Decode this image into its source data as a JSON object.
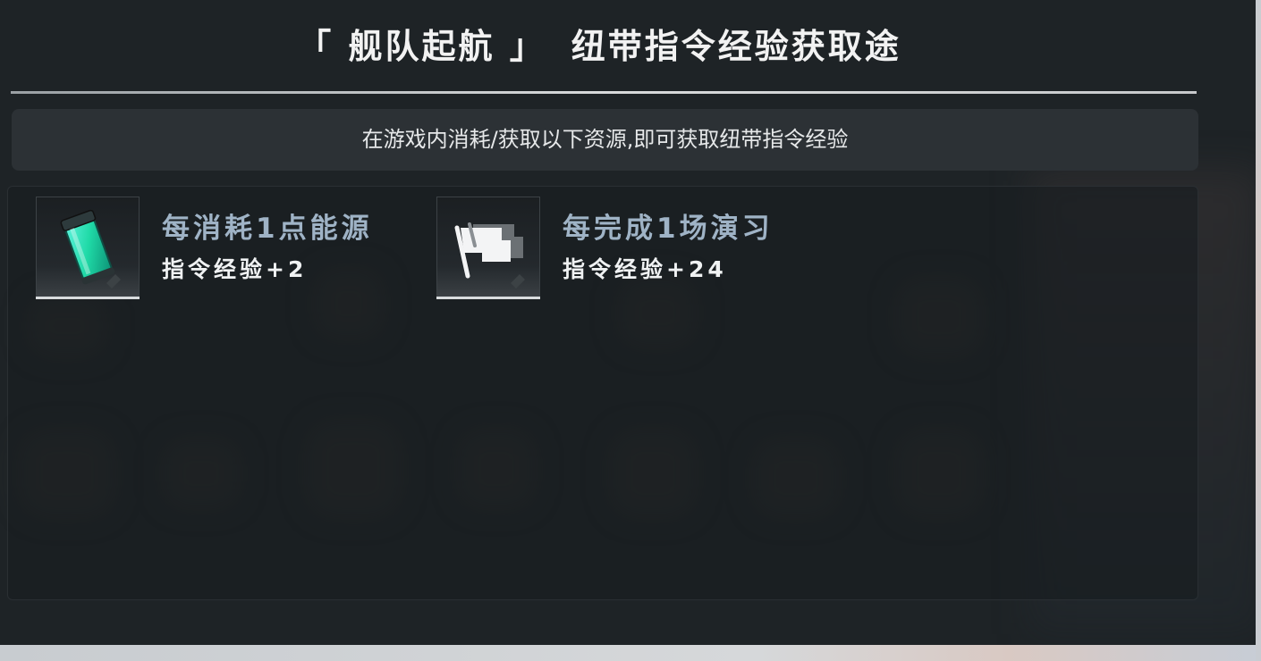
{
  "header": {
    "title_bracketed": "「 舰队起航 」",
    "title_main": "纽带指令经验获取途"
  },
  "notice": {
    "text": "在游戏内消耗/获取以下资源,即可获取纽带指令经验"
  },
  "items": [
    {
      "title": "每消耗1点能源",
      "value": "指令经验+2",
      "icon": "energy-canister-icon"
    },
    {
      "title": "每完成1场演习",
      "value": "指令经验+24",
      "icon": "flags-icon"
    }
  ],
  "colors": {
    "panel_bg": "#1e2326",
    "notice_bg": "#2c3135",
    "item_title": "#9fb3c6",
    "accent_energy": "#27e0b0"
  }
}
